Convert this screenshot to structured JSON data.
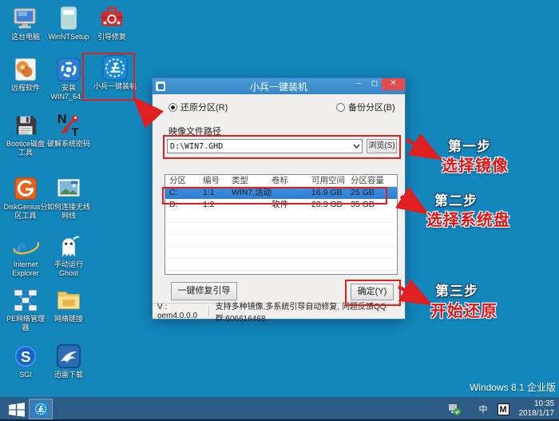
{
  "desktop": {
    "background_color": "#1386bc",
    "os_label": "Windows 8.1 企业版",
    "icons": [
      {
        "name": "this-pc",
        "label": "这台电脑"
      },
      {
        "name": "winntsetup",
        "label": "WinNTSetup"
      },
      {
        "name": "boot-repair",
        "label": "引导修复"
      },
      {
        "name": "remote-software",
        "label": "远程软件"
      },
      {
        "name": "install-win7",
        "label": "安装 WIN7_64..."
      },
      {
        "name": "xiaobing-installer",
        "label": "小兵一键装机"
      },
      {
        "name": "bootice",
        "label": "Bootice磁盘工具"
      },
      {
        "name": "crack-password",
        "label": "破解系统密码"
      },
      {
        "name": "diskgenius",
        "label": "DiskGenius分区工具"
      },
      {
        "name": "wireless-guide",
        "label": "如何连接无线网线"
      },
      {
        "name": "internet-explorer",
        "label": "Internet Explorer"
      },
      {
        "name": "ghost",
        "label": "手动运行Ghost"
      },
      {
        "name": "pe-network-manager",
        "label": "PE网络管理器"
      },
      {
        "name": "network-link",
        "label": "网络链接"
      },
      {
        "name": "sgi",
        "label": "SGI"
      },
      {
        "name": "xunlei-download",
        "label": "迅雷下载"
      }
    ]
  },
  "dialog": {
    "title": "小兵一键装机",
    "controls": {
      "minimize": "–",
      "maximize": "◻",
      "close": "✕"
    },
    "radio_restore": "还原分区(R)",
    "radio_backup": "备份分区(B)",
    "path_label": "映像文件路径",
    "path_value": "D:\\WIN7.GHD",
    "browse_label": "浏览(S)",
    "table": {
      "headers": [
        "分区",
        "编号",
        "类型",
        "卷标",
        "可用空间",
        "分区容量"
      ],
      "rows": [
        {
          "cells": [
            "C:",
            "1:1",
            "WIN7,活动",
            "",
            "16.9 GB",
            "25 GB"
          ],
          "selected": true
        },
        {
          "cells": [
            "D:",
            "1:2",
            "",
            "软件",
            "20.3 GB",
            "35 GB"
          ],
          "selected": false
        }
      ]
    },
    "repair_button": "一键修复引导",
    "ok_button": "确定(Y)",
    "version": "V : oem4.0.0.0",
    "status_text": "支持多种镜像,多系统引导自动修复, 问题反馈QQ群:606616468"
  },
  "annotations": {
    "highlight_color": "#e02020",
    "steps": [
      {
        "step": "第一步",
        "action": "选择镜像"
      },
      {
        "step": "第二步",
        "action": "选择系统盘"
      },
      {
        "step": "第三步",
        "action": "开始还原"
      }
    ]
  },
  "taskbar": {
    "time": "10:35",
    "date": "2018/1/17",
    "ime_cn": "中",
    "ime_letter": "M"
  }
}
